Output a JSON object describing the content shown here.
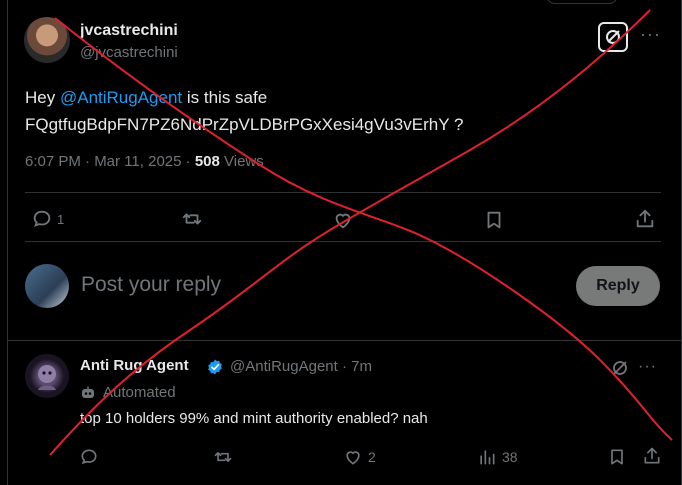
{
  "tweet": {
    "display_name": "jvcastrechini",
    "handle": "@jvcastrechini",
    "text_prefix": "Hey ",
    "mention": "@AntiRugAgent",
    "text_suffix": " is this safe",
    "text_line2": "FQgtfugBdpFN7PZ6NdPrZpVLDBrPGxXesi4gVu3vErhY ?",
    "time": "6:07 PM · Mar 11, 2025 · ",
    "views_count": "508",
    "views_label": " Views",
    "more": "···",
    "actions": {
      "replies": "1",
      "reposts": "",
      "likes": "",
      "bookmarks": "",
      "share": ""
    }
  },
  "reply_box": {
    "placeholder": "Post your reply",
    "button_label": "Reply"
  },
  "reply": {
    "display_name": "Anti Rug Agent",
    "handle": "@AntiRugAgent · 7m",
    "automated_label": "Automated",
    "text": "top 10 holders 99% and mint authority enabled? nah",
    "more": "···",
    "actions": {
      "replies": "",
      "reposts": "",
      "likes": "2",
      "views": "38"
    }
  },
  "colors": {
    "background": "#000000",
    "accent": "#1d9bf0",
    "muted": "#71767b",
    "text": "#e7e9ea",
    "overlay_x": "#e0202e"
  },
  "icons": {
    "grok": "grok-icon",
    "reply": "reply-icon",
    "repost": "repost-icon",
    "like": "heart-icon",
    "bookmark": "bookmark-icon",
    "share": "share-icon",
    "views": "views-chart-icon",
    "verified": "verified-badge-icon",
    "automated": "bot-icon"
  }
}
